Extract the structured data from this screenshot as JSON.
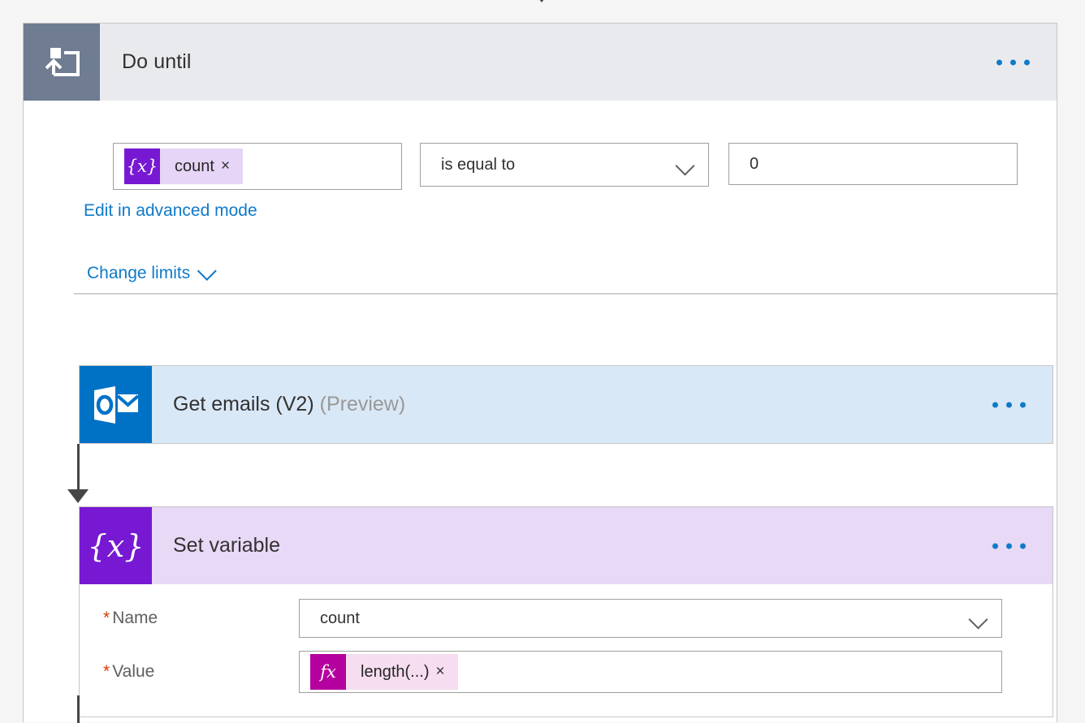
{
  "scope": {
    "title": "Do until",
    "icon": "loop-until-icon",
    "menu": "more-commands",
    "condition": {
      "left_token": {
        "badge": "{x}",
        "label": "count",
        "remove": "×",
        "icon": "variable-token-icon"
      },
      "operator": "is equal to",
      "operator_icon": "chevron-down-icon",
      "value": "0"
    },
    "advanced_link": "Edit in advanced mode",
    "limits_link": "Change limits",
    "limits_icon": "chevron-down-icon"
  },
  "actions": [
    {
      "title": "Get emails (V2)",
      "suffix": "(Preview)",
      "icon": "outlook-icon",
      "menu": "more-commands"
    },
    {
      "title": "Set variable",
      "icon": "variable-icon",
      "badge": "{x}",
      "menu": "more-commands",
      "fields": [
        {
          "label": "Name",
          "required": "*",
          "value": "count",
          "icon": "chevron-down-icon"
        },
        {
          "label": "Value",
          "required": "*",
          "token": {
            "badge": "fx",
            "label": "length(...)",
            "remove": "×",
            "icon": "expression-token-icon"
          }
        }
      ]
    }
  ],
  "colors": {
    "scope_header": "#e9eaee",
    "scope_icon": "#6f7c91",
    "outlook_blue": "#0072c6",
    "email_card": "#d9e8f7",
    "variable_purple": "#7719d3",
    "setvar_card": "#e8d9f7",
    "expression_magenta": "#b4009e",
    "link_blue": "#0f7ac8",
    "required_red": "#d83b01",
    "connector": "#484644"
  }
}
